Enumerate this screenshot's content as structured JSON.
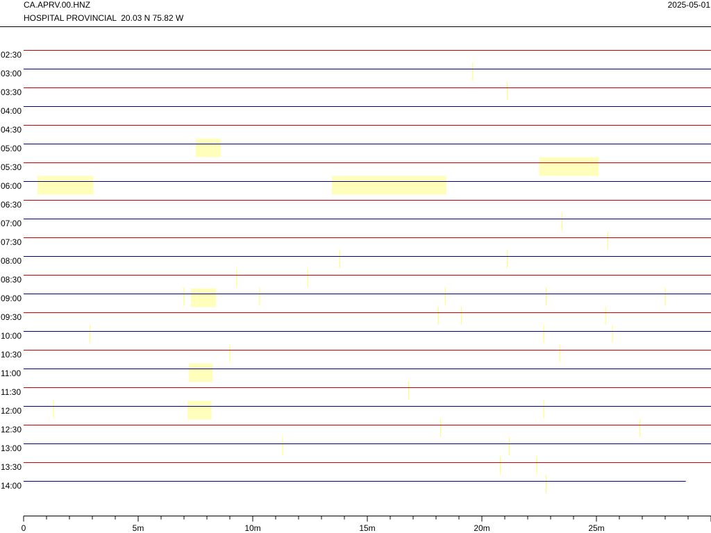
{
  "header": {
    "station": "CA.APRV.00.HNZ",
    "location": "HOSPITAL PROVINCIAL  20.03 N 75.82 W",
    "date": "2025-05-01"
  },
  "chart_data": {
    "type": "heatmap",
    "title": "CA.APRV.00.HNZ",
    "subtitle": "HOSPITAL PROVINCIAL  20.03 N 75.82 W",
    "date": "2025-05-01",
    "xlabel": "",
    "ylabel": "",
    "xlim": [
      0,
      30
    ],
    "x_ticks": [
      "0",
      "5m",
      "10m",
      "15m",
      "20m",
      "25m"
    ],
    "x_tick_values": [
      0,
      5,
      10,
      15,
      20,
      25
    ],
    "rows": [
      "02:30",
      "03:00",
      "03:30",
      "04:00",
      "04:30",
      "05:00",
      "05:30",
      "06:00",
      "06:30",
      "07:00",
      "07:30",
      "08:00",
      "08:30",
      "09:00",
      "09:30",
      "10:00",
      "10:30",
      "11:00",
      "11:30",
      "12:00",
      "12:30",
      "13:00",
      "13:30",
      "14:00"
    ],
    "row_line_colors": {
      "half_hour": "#cc0000",
      "hour": "#000080"
    },
    "last_row_end_minute": 28.9,
    "highlight_color": "#ffffbb",
    "spike_color": "#ffff66",
    "blocks": [
      {
        "row": "05:00",
        "start": 7.5,
        "end": 8.6
      },
      {
        "row": "05:30",
        "start": 22.5,
        "end": 25.1
      },
      {
        "row": "06:00",
        "start": 0.6,
        "end": 3.05
      },
      {
        "row": "06:00",
        "start": 13.45,
        "end": 18.45
      },
      {
        "row": "09:00",
        "start": 7.3,
        "end": 8.4
      },
      {
        "row": "11:00",
        "start": 7.2,
        "end": 8.25
      },
      {
        "row": "12:00",
        "start": 7.15,
        "end": 8.2
      }
    ],
    "spikes": [
      {
        "row": "03:00",
        "x": 19.6
      },
      {
        "row": "03:30",
        "x": 21.1
      },
      {
        "row": "07:00",
        "x": 23.5
      },
      {
        "row": "07:30",
        "x": 25.5
      },
      {
        "row": "08:00",
        "x": 13.8
      },
      {
        "row": "08:00",
        "x": 21.1
      },
      {
        "row": "08:30",
        "x": 9.3
      },
      {
        "row": "08:30",
        "x": 12.4
      },
      {
        "row": "09:00",
        "x": 7.0
      },
      {
        "row": "09:00",
        "x": 10.3
      },
      {
        "row": "09:00",
        "x": 18.4
      },
      {
        "row": "09:00",
        "x": 22.8
      },
      {
        "row": "09:00",
        "x": 28.0
      },
      {
        "row": "09:30",
        "x": 18.1
      },
      {
        "row": "09:30",
        "x": 19.1
      },
      {
        "row": "09:30",
        "x": 25.4
      },
      {
        "row": "10:00",
        "x": 2.9
      },
      {
        "row": "10:00",
        "x": 22.7
      },
      {
        "row": "10:00",
        "x": 25.7
      },
      {
        "row": "10:30",
        "x": 9.0
      },
      {
        "row": "10:30",
        "x": 23.4
      },
      {
        "row": "11:30",
        "x": 16.8
      },
      {
        "row": "12:00",
        "x": 1.3
      },
      {
        "row": "12:00",
        "x": 22.7
      },
      {
        "row": "12:30",
        "x": 18.2
      },
      {
        "row": "12:30",
        "x": 26.9
      },
      {
        "row": "13:00",
        "x": 11.3
      },
      {
        "row": "13:00",
        "x": 21.2
      },
      {
        "row": "13:30",
        "x": 20.8
      },
      {
        "row": "13:30",
        "x": 22.4
      },
      {
        "row": "14:00",
        "x": 22.8
      }
    ]
  }
}
